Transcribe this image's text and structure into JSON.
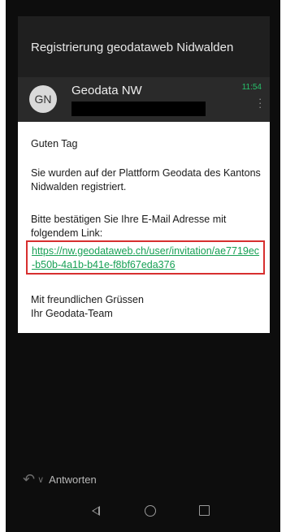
{
  "email": {
    "subject": "Registrierung geodataweb Nidwalden",
    "sender_initials": "GN",
    "sender_name": "Geodata NW",
    "time": "11:54",
    "body": {
      "greeting": "Guten Tag",
      "paragraph1": "Sie wurden auf der Plattform Geodata des Kantons Nidwalden registriert.",
      "paragraph2": "Bitte bestätigen Sie Ihre E-Mail Adresse mit folgendem Link:",
      "link": "https://nw.geodataweb.ch/user/invitation/ae7719ec-b50b-4a1b-b41e-f8bf67eda376",
      "closing1": "Mit freundlichen Grüssen",
      "closing2": "Ihr Geodata-Team"
    }
  },
  "footer": {
    "reply_label": "Antworten"
  },
  "colors": {
    "link": "#17a055",
    "time": "#27c26b",
    "highlight_box": "#d72f2f"
  }
}
